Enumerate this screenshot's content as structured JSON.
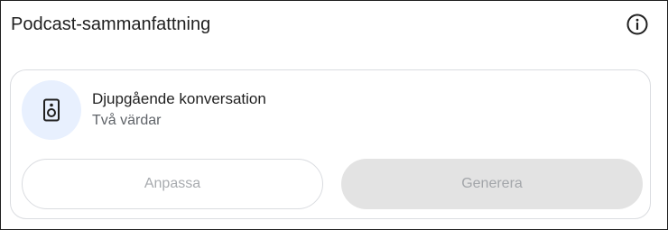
{
  "panel": {
    "title": "Podcast-sammanfattning",
    "info_icon": "info-icon"
  },
  "format_card": {
    "icon": "speaker-icon",
    "title": "Djupgående konversation",
    "subtitle": "Två värdar"
  },
  "actions": {
    "customize_label": "Anpassa",
    "generate_label": "Generera",
    "customize_disabled": true,
    "generate_disabled": true
  },
  "colors": {
    "icon_circle_bg": "#e8f0fe",
    "card_border": "#dadce0",
    "disabled_text": "#a8abaf",
    "disabled_fill": "#e3e3e3"
  }
}
